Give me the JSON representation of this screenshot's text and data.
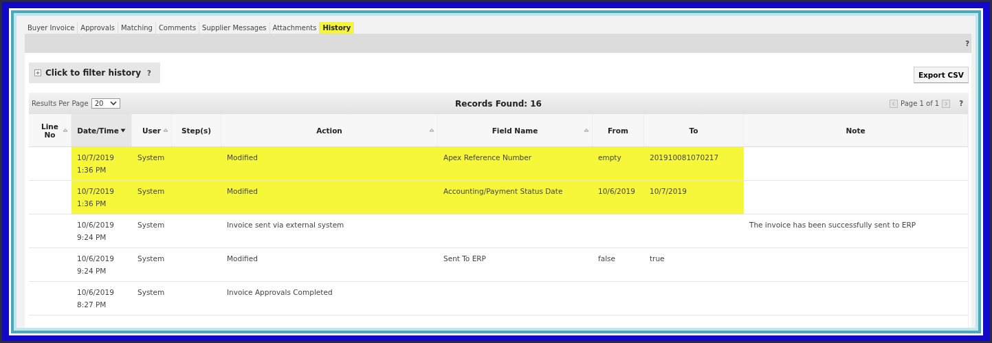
{
  "tabs": [
    {
      "label": "Buyer Invoice",
      "selected": false
    },
    {
      "label": "Approvals",
      "selected": false
    },
    {
      "label": "Matching",
      "selected": false
    },
    {
      "label": "Comments",
      "selected": false
    },
    {
      "label": "Supplier Messages",
      "selected": false
    },
    {
      "label": "Attachments",
      "selected": false
    },
    {
      "label": "History",
      "selected": true
    }
  ],
  "section_help": "?",
  "filter": {
    "label": "Click to filter history",
    "help": "?"
  },
  "export_button": "Export CSV",
  "toolbar": {
    "results_label": "Results Per Page",
    "results_value": "20",
    "records_found": "Records Found: 16",
    "pager": "Page 1 of 1",
    "help": "?"
  },
  "table": {
    "columns": [
      {
        "label": "Line No",
        "kind": "sortable"
      },
      {
        "label": "Date/Time",
        "kind": "descending"
      },
      {
        "label": "User",
        "kind": "sortable"
      },
      {
        "label": "Step(s)",
        "kind": "plain"
      },
      {
        "label": "Action",
        "kind": "sortable"
      },
      {
        "label": "Field Name",
        "kind": "sortable"
      },
      {
        "label": "From",
        "kind": "plain"
      },
      {
        "label": "To",
        "kind": "plain"
      },
      {
        "label": "Note",
        "kind": "plain"
      }
    ],
    "rows": [
      {
        "highlighted": true,
        "cells": [
          "",
          "10/7/2019 1:36 PM",
          "System",
          "",
          "Modified",
          "Apex Reference Number",
          "empty",
          "201910081070217",
          ""
        ]
      },
      {
        "highlighted": true,
        "cells": [
          "",
          "10/7/2019 1:36 PM",
          "System",
          "",
          "Modified",
          "Accounting/Payment Status Date",
          "10/6/2019",
          "10/7/2019",
          ""
        ]
      },
      {
        "highlighted": false,
        "cells": [
          "",
          "10/6/2019 9:24 PM",
          "System",
          "",
          "Invoice sent via external system",
          "",
          "",
          "",
          "The invoice has been successfully sent to ERP"
        ]
      },
      {
        "highlighted": false,
        "cells": [
          "",
          "10/6/2019 9:24 PM",
          "System",
          "",
          "Modified",
          "Sent To ERP",
          "false",
          "true",
          ""
        ]
      },
      {
        "highlighted": false,
        "cells": [
          "",
          "10/6/2019 8:27 PM",
          "System",
          "",
          "Invoice Approvals Completed",
          "",
          "",
          "",
          ""
        ]
      }
    ]
  }
}
